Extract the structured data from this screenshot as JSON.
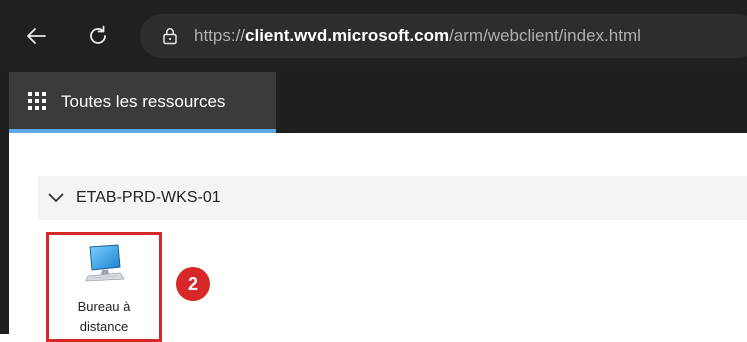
{
  "browser": {
    "url": {
      "prefix": "https://",
      "host": "client.wvd.microsoft.com",
      "path": "/arm/webclient/index.html"
    },
    "icons": {
      "back": "back-arrow-icon",
      "refresh": "refresh-icon",
      "lock": "lock-icon"
    }
  },
  "app": {
    "tab_all_resources": "Toutes les ressources",
    "tab_icon": "grid-icon",
    "accent_color": "#5ea8e8"
  },
  "content": {
    "group_name": "ETAB-PRD-WKS-01",
    "resource": {
      "label_line1": "Bureau à",
      "label_line2": "distance",
      "icon": "remote-desktop-icon"
    },
    "step_badge": "2",
    "highlight_color": "#d62828"
  }
}
